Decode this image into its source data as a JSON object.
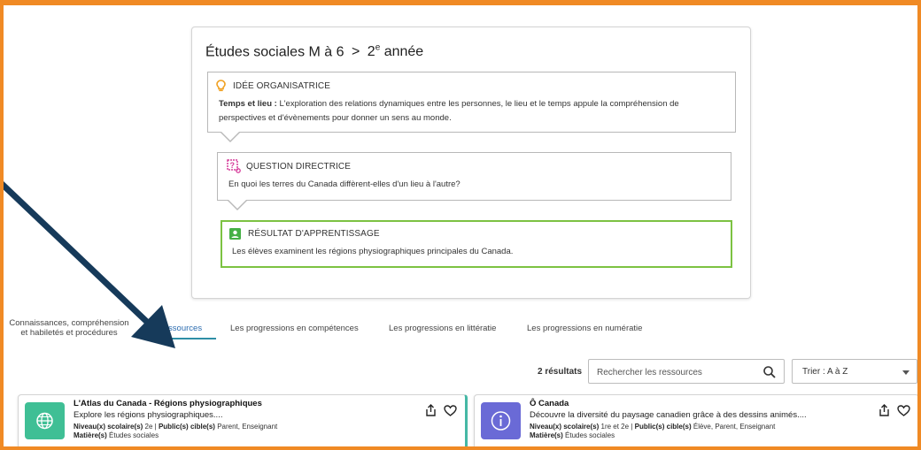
{
  "breadcrumb": {
    "subject": "Études sociales M à 6",
    "separator": ">",
    "grade_num": "2",
    "grade_sup": "e",
    "grade_word": "année"
  },
  "idea": {
    "heading": "IDÉE ORGANISATRICE",
    "label": "Temps et lieu :",
    "line1": "L'exploration des relations dynamiques entre les personnes, le lieu et le temps appule la compréhension de",
    "line2": "perspectives et d'évènements pour donner un sens au monde."
  },
  "question": {
    "heading": "QUESTION DIRECTRICE",
    "text": "En quoi les terres du Canada diffèrent-elles d'un lieu à l'autre?"
  },
  "outcome": {
    "heading": "RÉSULTAT D'APPRENTISSAGE",
    "text": "Les élèves examinent les régions physiographiques principales du Canada."
  },
  "tabs": [
    {
      "line1": "Connaissances, compréhension",
      "line2": "et habiletés et procédures"
    },
    {
      "label": "Ressources"
    },
    {
      "label": "Les progressions en compétences"
    },
    {
      "label": "Les progressions en littératie"
    },
    {
      "label": "Les progressions en numératie"
    }
  ],
  "results": {
    "count": "2 résultats",
    "search_placeholder": "Rechercher les ressources",
    "sort": "Trier : A à Z"
  },
  "cards": [
    {
      "title": "L'Atlas du Canada - Régions physiographiques",
      "desc": "Explore les régions physiographiques....",
      "level_label": "Niveau(x) scolaire(s)",
      "level": "2e",
      "public_label": "Public(s) cible(s)",
      "public": "Parent, Enseignant",
      "subject_label": "Matière(s)",
      "subject": "Études sociales",
      "thumb_icon": "globe-icon",
      "thumb_color": "#3fbf95"
    },
    {
      "title": "Ô Canada",
      "desc": "Découvre la diversité du paysage canadien grâce à des dessins animés....",
      "level_label": "Niveau(x) scolaire(s)",
      "level": "1re et 2e",
      "public_label": "Public(s) cible(s)",
      "public": "Élève, Parent, Enseignant",
      "subject_label": "Matière(s)",
      "subject": "Études sociales",
      "thumb_icon": "info-icon",
      "thumb_color": "#6a6ad6"
    }
  ],
  "colors": {
    "frame": "#f08a24",
    "outcome_border": "#7cc242",
    "arrow": "#163a5a",
    "tab_underline": "#2e8fa6"
  }
}
